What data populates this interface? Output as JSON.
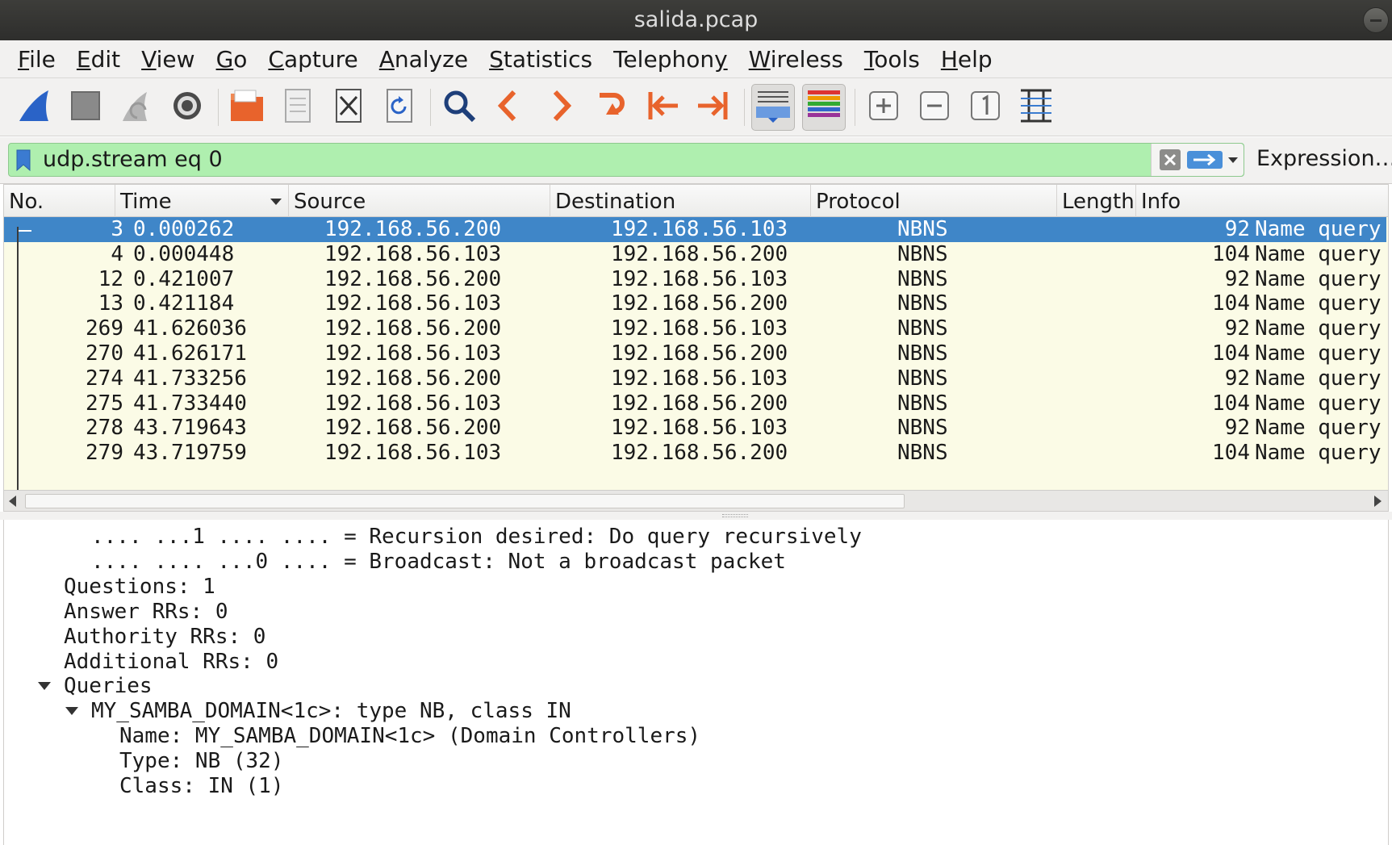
{
  "window": {
    "title": "salida.pcap"
  },
  "menu": [
    {
      "pre": "",
      "mn": "F",
      "post": "ile"
    },
    {
      "pre": "",
      "mn": "E",
      "post": "dit"
    },
    {
      "pre": "",
      "mn": "V",
      "post": "iew"
    },
    {
      "pre": "",
      "mn": "G",
      "post": "o"
    },
    {
      "pre": "",
      "mn": "C",
      "post": "apture"
    },
    {
      "pre": "",
      "mn": "A",
      "post": "nalyze"
    },
    {
      "pre": "",
      "mn": "S",
      "post": "tatistics"
    },
    {
      "pre": "Telephon",
      "mn": "y",
      "post": ""
    },
    {
      "pre": "",
      "mn": "W",
      "post": "ireless"
    },
    {
      "pre": "",
      "mn": "T",
      "post": "ools"
    },
    {
      "pre": "",
      "mn": "H",
      "post": "elp"
    }
  ],
  "toolbar": {
    "icons": [
      "shark-fin-start-icon",
      "stop-icon",
      "restart-icon",
      "options-gear-icon",
      "open-folder-icon",
      "save-file-icon",
      "close-file-icon",
      "reload-icon",
      "find-icon",
      "go-back-icon",
      "go-forward-icon",
      "go-to-packet-icon",
      "first-packet-icon",
      "last-packet-icon",
      "autoscroll-icon",
      "colorize-icon",
      "zoom-in-icon",
      "zoom-out-icon",
      "normal-size-icon",
      "resize-columns-icon"
    ],
    "active": [
      "autoscroll-icon",
      "colorize-icon"
    ]
  },
  "filter": {
    "value": "udp.stream eq 0",
    "expression_label": "Expression…"
  },
  "packet_list": {
    "columns": [
      "No.",
      "Time",
      "Source",
      "Destination",
      "Protocol",
      "Length",
      "Info"
    ],
    "rows": [
      {
        "no": "3",
        "time": "0.000262",
        "source": "192.168.56.200",
        "destination": "192.168.56.103",
        "protocol": "NBNS",
        "length": "92",
        "info": "Name query",
        "selected": true
      },
      {
        "no": "4",
        "time": "0.000448",
        "source": "192.168.56.103",
        "destination": "192.168.56.200",
        "protocol": "NBNS",
        "length": "104",
        "info": "Name query"
      },
      {
        "no": "12",
        "time": "0.421007",
        "source": "192.168.56.200",
        "destination": "192.168.56.103",
        "protocol": "NBNS",
        "length": "92",
        "info": "Name query"
      },
      {
        "no": "13",
        "time": "0.421184",
        "source": "192.168.56.103",
        "destination": "192.168.56.200",
        "protocol": "NBNS",
        "length": "104",
        "info": "Name query"
      },
      {
        "no": "269",
        "time": "41.626036",
        "source": "192.168.56.200",
        "destination": "192.168.56.103",
        "protocol": "NBNS",
        "length": "92",
        "info": "Name query"
      },
      {
        "no": "270",
        "time": "41.626171",
        "source": "192.168.56.103",
        "destination": "192.168.56.200",
        "protocol": "NBNS",
        "length": "104",
        "info": "Name query"
      },
      {
        "no": "274",
        "time": "41.733256",
        "source": "192.168.56.200",
        "destination": "192.168.56.103",
        "protocol": "NBNS",
        "length": "92",
        "info": "Name query"
      },
      {
        "no": "275",
        "time": "41.733440",
        "source": "192.168.56.103",
        "destination": "192.168.56.200",
        "protocol": "NBNS",
        "length": "104",
        "info": "Name query"
      },
      {
        "no": "278",
        "time": "43.719643",
        "source": "192.168.56.200",
        "destination": "192.168.56.103",
        "protocol": "NBNS",
        "length": "92",
        "info": "Name query"
      },
      {
        "no": "279",
        "time": "43.719759",
        "source": "192.168.56.103",
        "destination": "192.168.56.200",
        "protocol": "NBNS",
        "length": "104",
        "info": "Name query"
      }
    ]
  },
  "detail": {
    "lines": [
      {
        "text": ".... ...1 .... .... = Recursion desired: Do query recursively",
        "level": 2,
        "toggle": false
      },
      {
        "text": ".... .... ...0 .... = Broadcast: Not a broadcast packet",
        "level": 2,
        "toggle": false
      },
      {
        "text": "Questions: 1",
        "level": 1,
        "toggle": false
      },
      {
        "text": "Answer RRs: 0",
        "level": 1,
        "toggle": false
      },
      {
        "text": "Authority RRs: 0",
        "level": 1,
        "toggle": false
      },
      {
        "text": "Additional RRs: 0",
        "level": 1,
        "toggle": false
      },
      {
        "text": "Queries",
        "level": 1,
        "toggle": true
      },
      {
        "text": "MY_SAMBA_DOMAIN<1c>: type NB, class IN",
        "level": 2,
        "toggle": true
      },
      {
        "text": "Name: MY_SAMBA_DOMAIN<1c> (Domain Controllers)",
        "level": 3,
        "toggle": false
      },
      {
        "text": "Type: NB (32)",
        "level": 3,
        "toggle": false
      },
      {
        "text": "Class: IN (1)",
        "level": 3,
        "toggle": false
      }
    ]
  },
  "colors": {
    "selected_row": "#3f86c8",
    "udp_row": "#fbfbe6",
    "filter_valid": "#afefaf"
  }
}
